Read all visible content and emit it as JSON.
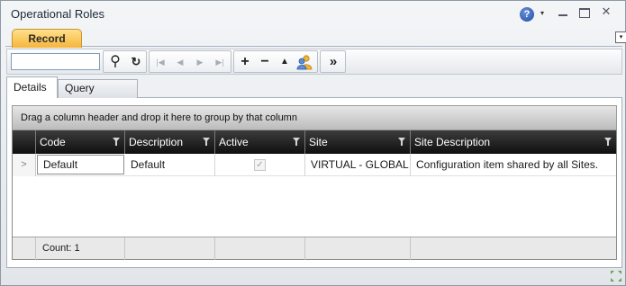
{
  "window": {
    "title": "Operational Roles",
    "help_icon": "?",
    "help_caret": "▾",
    "close_icon": "✕",
    "colors": {
      "title_gradient": "#e9ecef",
      "record_tab": "#f6b53c",
      "grid_header": "#1f1f1f"
    }
  },
  "ribbon": {
    "record_tab": "Record",
    "menu_glyph": "▾"
  },
  "toolbar": {
    "search_value": "",
    "search_icon_glyph": "⚲",
    "refresh_glyph": "↻",
    "first_glyph": "|◀",
    "prev_glyph": "◀",
    "next_glyph": "▶",
    "last_glyph": "▶|",
    "add_glyph": "+",
    "delete_glyph": "−",
    "up_glyph": "▲",
    "more_glyph": "»"
  },
  "tabs": {
    "details": "Details",
    "query_builder": "Query Builder"
  },
  "grid": {
    "group_panel_text": "Drag a column header and drop it here to group by that column",
    "columns": [
      "Code",
      "Description",
      "Active",
      "Site",
      "Site Description"
    ],
    "rows": [
      {
        "indicator": ">",
        "code": "Default",
        "description": "Default",
        "active": true,
        "active_glyph": "✓",
        "site": "VIRTUAL - GLOBAL",
        "site_description": "Configuration item shared by all Sites."
      }
    ],
    "footer_count": "Count: 1"
  }
}
